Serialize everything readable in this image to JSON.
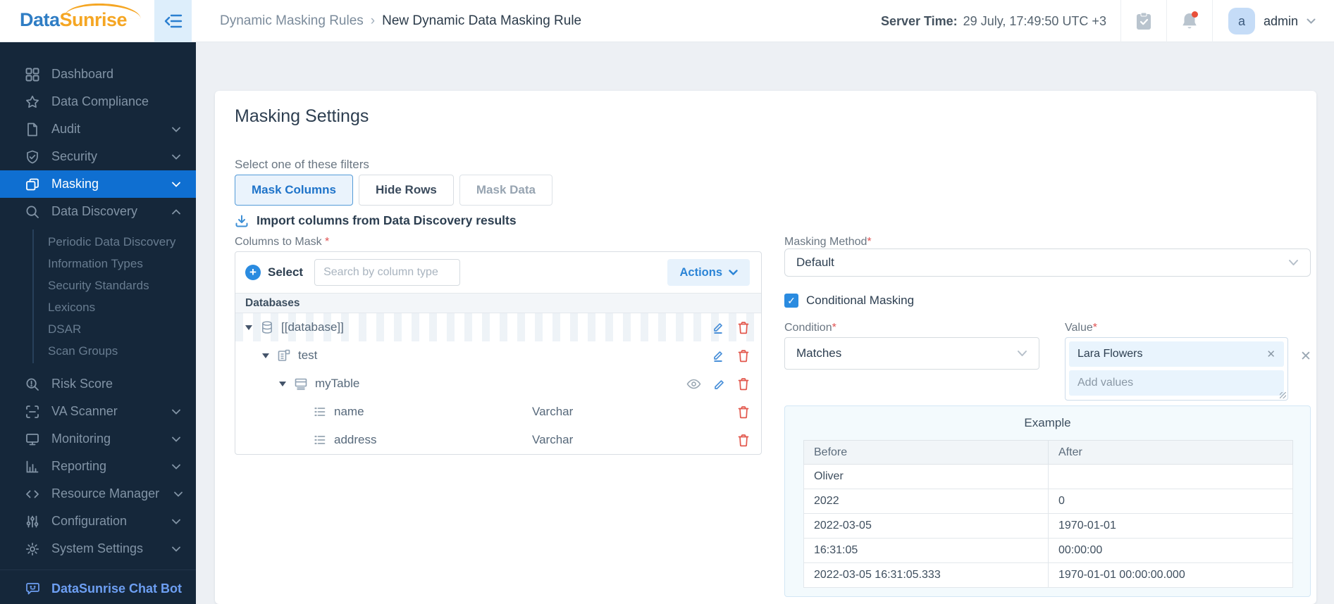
{
  "header": {
    "logo_part1": "Data",
    "logo_part2": "Sunrise",
    "breadcrumb_parent": "Dynamic Masking Rules",
    "breadcrumb_sep": "›",
    "breadcrumb_current": "New Dynamic Data Masking Rule",
    "server_time_label": "Server Time:",
    "server_time_value": "29 July, 17:49:50 UTC +3",
    "avatar_initial": "a",
    "user_name": "admin"
  },
  "sidebar": {
    "items": [
      {
        "label": "Dashboard"
      },
      {
        "label": "Data Compliance"
      },
      {
        "label": "Audit"
      },
      {
        "label": "Security"
      },
      {
        "label": "Masking"
      },
      {
        "label": "Data Discovery"
      },
      {
        "label": "Risk Score"
      },
      {
        "label": "VA Scanner"
      },
      {
        "label": "Monitoring"
      },
      {
        "label": "Reporting"
      },
      {
        "label": "Resource Manager"
      },
      {
        "label": "Configuration"
      },
      {
        "label": "System Settings"
      }
    ],
    "discovery_subitems": [
      {
        "label": "Periodic Data Discovery"
      },
      {
        "label": "Information Types"
      },
      {
        "label": "Security Standards"
      },
      {
        "label": "Lexicons"
      },
      {
        "label": "DSAR"
      },
      {
        "label": "Scan Groups"
      }
    ],
    "chatbot_label": "DataSunrise Chat Bot"
  },
  "settings": {
    "title": "Masking Settings",
    "filters_label": "Select one of these filters",
    "filter_mask_columns": "Mask Columns",
    "filter_hide_rows": "Hide Rows",
    "filter_mask_data": "Mask Data",
    "import_label": "Import columns from Data Discovery results",
    "columns_to_mask_label": "Columns to Mask",
    "required_mark": "*",
    "select_label": "Select",
    "search_placeholder": "Search by column type",
    "actions_label": "Actions",
    "tree_header": "Databases",
    "tree": {
      "database": "[[database]]",
      "schema": "test",
      "table": "myTable",
      "columns": [
        {
          "name": "name",
          "type": "Varchar"
        },
        {
          "name": "address",
          "type": "Varchar"
        }
      ]
    }
  },
  "method": {
    "label": "Masking Method",
    "value": "Default",
    "conditional_label": "Conditional Masking",
    "checkbox_mark": "✓",
    "condition_label": "Condition",
    "condition_value": "Matches",
    "value_label": "Value",
    "value_tag": "Lara Flowers",
    "tag_remove": "✕",
    "clear_mark": "✕",
    "add_values_placeholder": "Add values"
  },
  "example": {
    "title": "Example",
    "col_before": "Before",
    "col_after": "After",
    "rows": [
      {
        "before": "Oliver",
        "after": ""
      },
      {
        "before": "2022",
        "after": "0"
      },
      {
        "before": "2022-03-05",
        "after": "1970-01-01"
      },
      {
        "before": "16:31:05",
        "after": "00:00:00"
      },
      {
        "before": "2022-03-05 16:31:05.333",
        "after": "1970-01-01 00:00:00.000"
      }
    ]
  },
  "colors": {
    "accent_blue": "#1372d3",
    "sidebar_bg": "#15273a",
    "active_item_bg": "#0f6fd1",
    "danger_red": "#e2574c",
    "logo_blue": "#2f7dc4",
    "logo_orange": "#f5a623",
    "notification_dot": "#e8503a"
  }
}
